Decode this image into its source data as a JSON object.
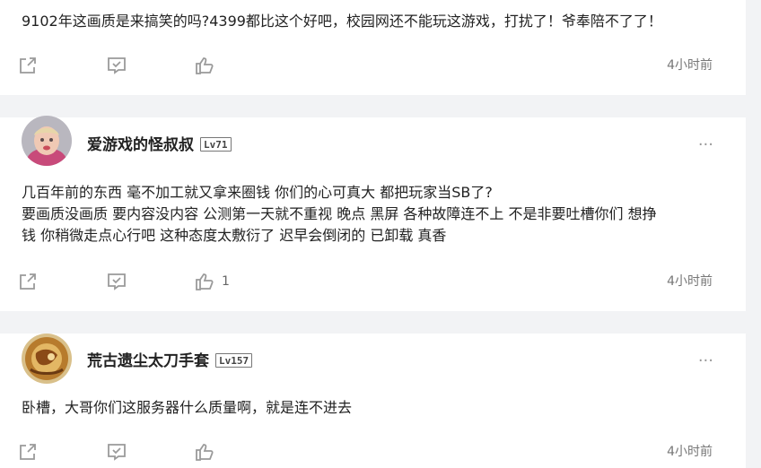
{
  "comments": [
    {
      "content_lines": [
        "9102年这画质是来搞笑的吗?4399都比这个好吧，校园网还不能玩这游戏，打扰了！爷奉陪不了了！"
      ],
      "like_count": "",
      "time": "4小时前"
    },
    {
      "username": "爱游戏的怪叔叔",
      "level": "Lv71",
      "more": "···",
      "content_lines": [
        "几百年前的东西 毫不加工就又拿来圈钱 你们的心可真大 都把玩家当SB了?",
        "要画质没画质 要内容没内容 公测第一天就不重视 晚点 黑屏 各种故障连不上 不是非要吐槽你们 想挣",
        "钱 你稍微走点心行吧 这种态度太敷衍了 迟早会倒闭的 已卸载 真香"
      ],
      "like_count": "1",
      "time": "4小时前"
    },
    {
      "username": "荒古遗尘太刀手套",
      "level": "Lv157",
      "more": "···",
      "content_lines": [
        "卧槽，大哥你们这服务器什么质量啊，就是连不进去"
      ],
      "like_count": "",
      "time": "4小时前"
    }
  ],
  "icons": {
    "share": "share-icon",
    "reply": "reply-icon",
    "like": "thumbs-up-icon",
    "more": "more-dots-icon"
  },
  "colors": {
    "background": "#f2f3f5",
    "card": "#ffffff",
    "icon": "#9a9a9a",
    "text": "#222222",
    "meta": "#777777"
  }
}
